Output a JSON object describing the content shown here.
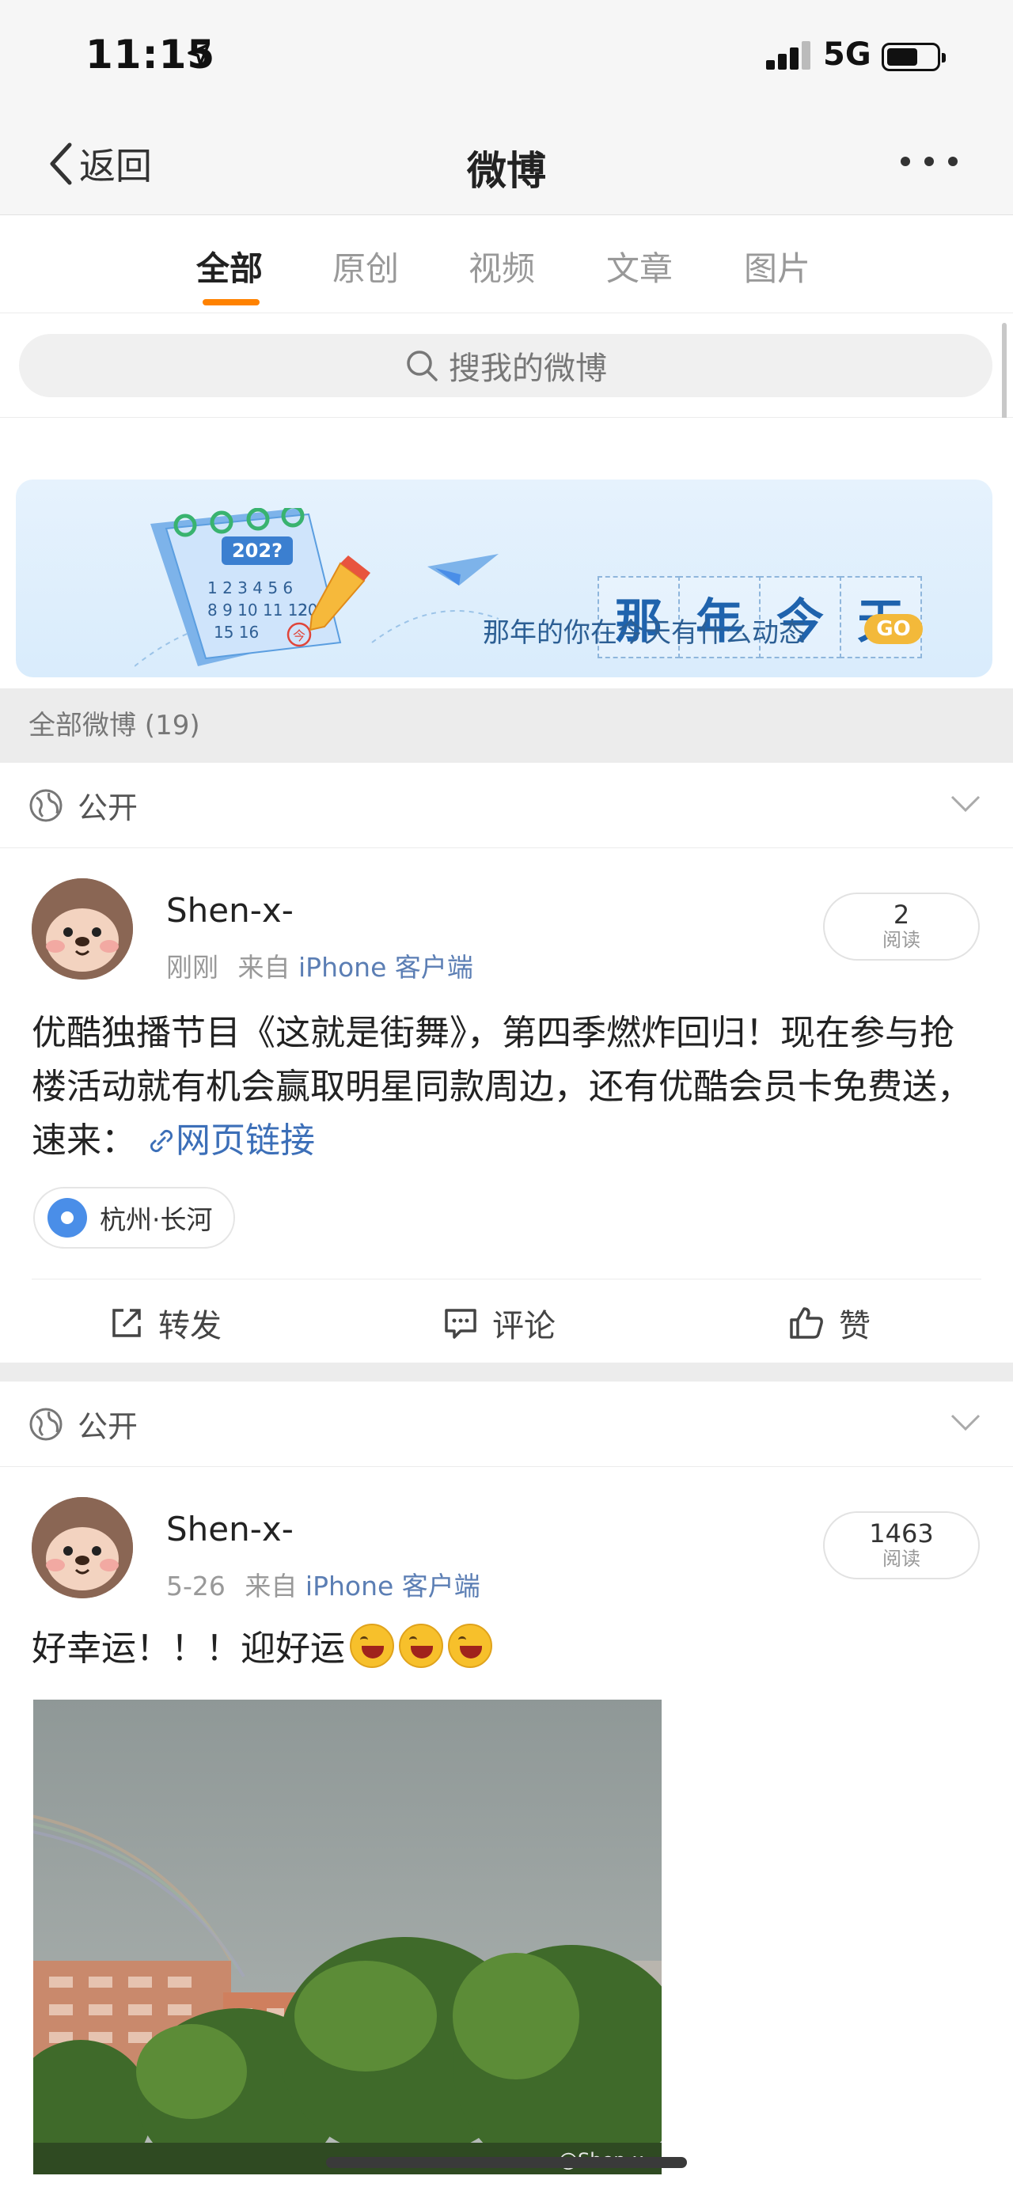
{
  "status_bar": {
    "time": "11:15",
    "network": "5G"
  },
  "nav": {
    "back_label": "返回",
    "title": "微博"
  },
  "tabs": [
    {
      "label": "全部",
      "active": true
    },
    {
      "label": "原创"
    },
    {
      "label": "视频"
    },
    {
      "label": "文章"
    },
    {
      "label": "图片"
    }
  ],
  "search": {
    "placeholder": "搜我的微博"
  },
  "banner": {
    "title_chars": [
      "那",
      "年",
      "今",
      "天"
    ],
    "subtitle": "那年的你在今天有什么动态",
    "go_label": "GO",
    "calendar_year": "202?",
    "calendar_mark": "今"
  },
  "section_header": "全部微博 (19)",
  "posts": [
    {
      "privacy": "公开",
      "username": "Shen-x-",
      "time": "刚刚",
      "source_prefix": "来自",
      "source": "iPhone 客户端",
      "read_count": "2",
      "read_label": "阅读",
      "text": "优酷独播节目《这就是街舞》，第四季燃炸回归！现在参与抢楼活动就有机会赢取明星同款周边，还有优酷会员卡免费送，速来：",
      "link_label": "网页链接",
      "location": "杭州·长河",
      "actions": {
        "repost": "转发",
        "comment": "评论",
        "like": "赞"
      }
    },
    {
      "privacy": "公开",
      "username": "Shen-x-",
      "time": "5-26",
      "source_prefix": "来自",
      "source": "iPhone 客户端",
      "read_count": "1463",
      "read_label": "阅读",
      "text": "好幸运！！！迎好运",
      "emoji_count": 3,
      "photo_watermark": "@Shen-x-"
    }
  ],
  "colors": {
    "accent": "#ff8200",
    "link": "#3c6fb8",
    "banner_title": "#1f63ad"
  }
}
